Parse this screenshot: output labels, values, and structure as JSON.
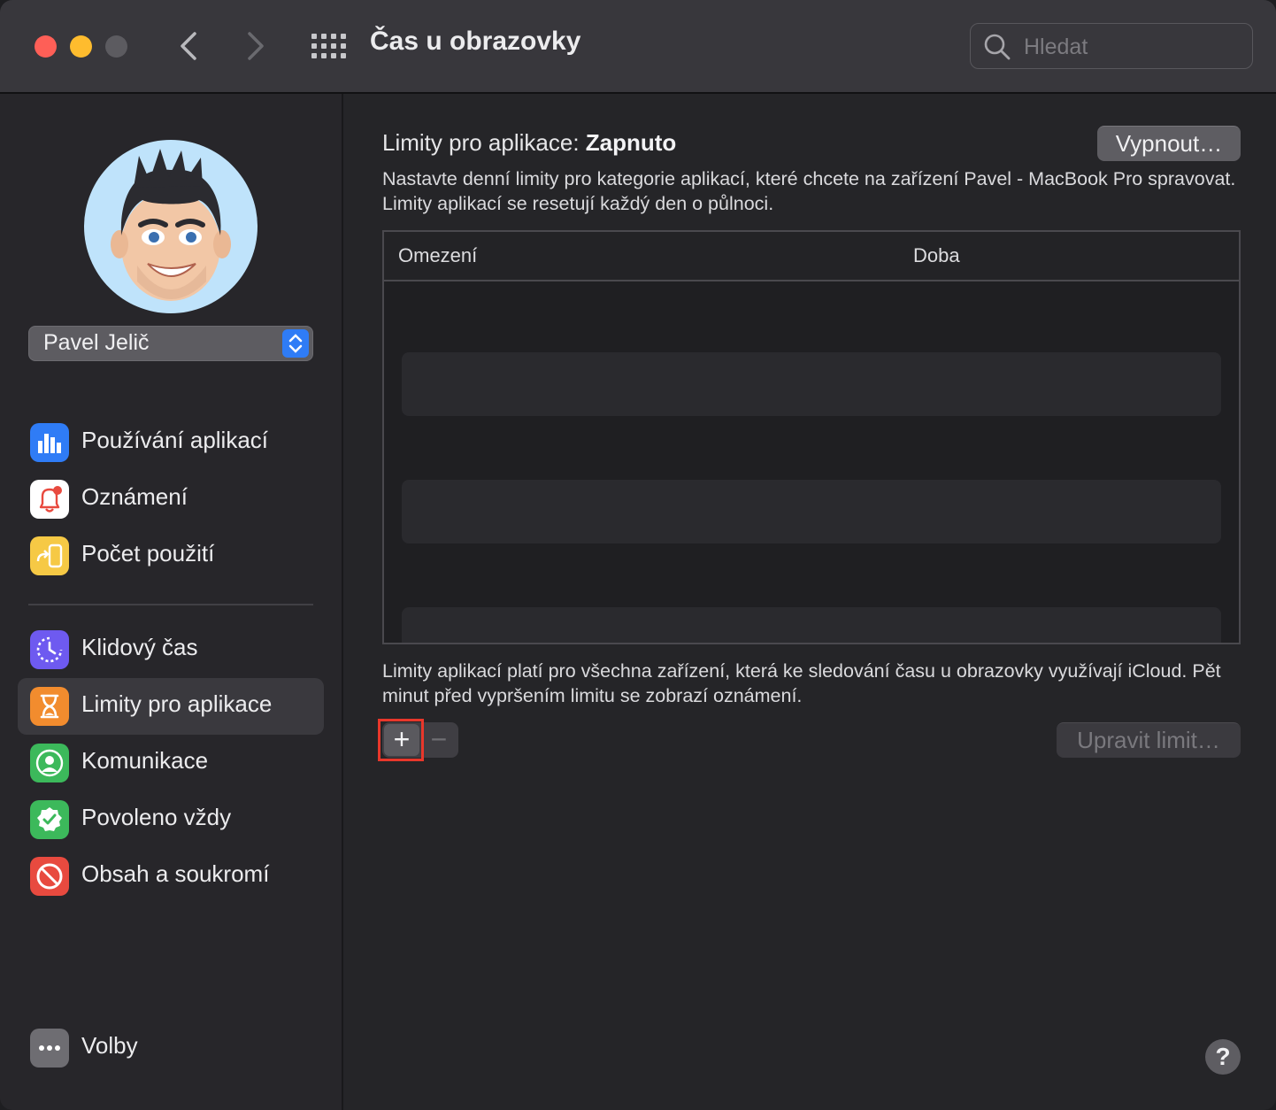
{
  "window": {
    "title": "Čas u obrazovky"
  },
  "search": {
    "placeholder": "Hledat"
  },
  "sidebar": {
    "user_name": "Pavel Jelič",
    "items": [
      {
        "label": "Používání aplikací",
        "icon": "bar-chart-icon",
        "color": "#2f7cf6"
      },
      {
        "label": "Oznámení",
        "icon": "bell-icon",
        "color": "#ffffff"
      },
      {
        "label": "Počet použití",
        "icon": "pickup-icon",
        "color": "#f6c945"
      },
      {
        "label": "Klidový čas",
        "icon": "downtime-icon",
        "color": "#6e5af0"
      },
      {
        "label": "Limity pro aplikace",
        "icon": "hourglass-icon",
        "color": "#f28c2e"
      },
      {
        "label": "Komunikace",
        "icon": "person-icon",
        "color": "#3cb95b"
      },
      {
        "label": "Povoleno vždy",
        "icon": "checkmark-badge-icon",
        "color": "#3cb95b"
      },
      {
        "label": "Obsah a soukromí",
        "icon": "prohibited-icon",
        "color": "#e84a3f"
      }
    ],
    "active_item": "Limity pro aplikace",
    "options_label": "Volby"
  },
  "main": {
    "heading_prefix": "Limity pro aplikace:",
    "heading_state": "Zapnuto",
    "turn_off_button": "Vypnout…",
    "description": "Nastavte denní limity pro kategorie aplikací, které chcete na zařízení Pavel - MacBook Pro spravovat. Limity aplikací se resetují každý den o půlnoci.",
    "table": {
      "columns": [
        "Omezení",
        "Doba"
      ],
      "rows": []
    },
    "footer_note": "Limity aplikací platí pro všechna zařízení, která ke sledování času u obrazovky využívají iCloud. Pět minut před vypršením limitu se zobrazí oznámení.",
    "add_symbol": "+",
    "remove_symbol": "−",
    "edit_button": "Upravit limit…",
    "help_symbol": "?"
  },
  "colors": {
    "highlight": "#e8372b",
    "accent": "#2f7cf6"
  }
}
